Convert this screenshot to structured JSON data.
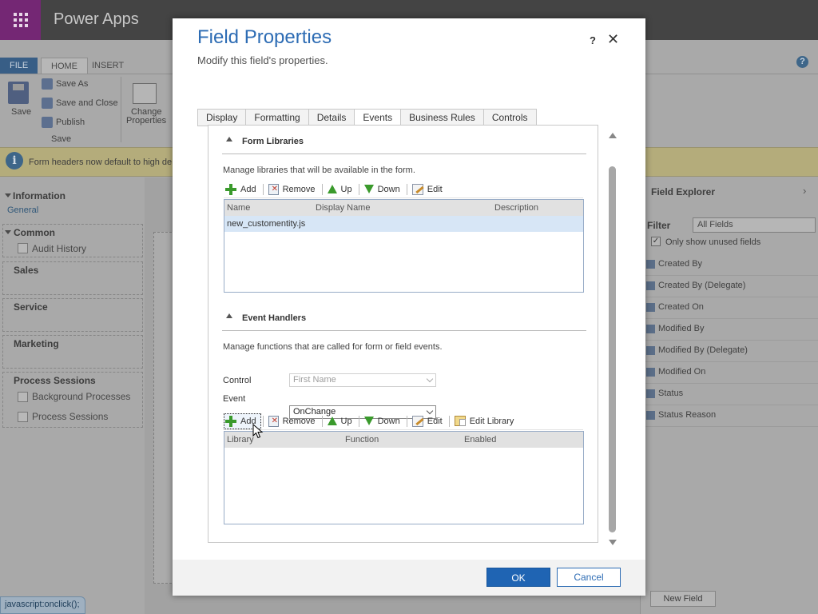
{
  "app": {
    "title": "Power Apps"
  },
  "ribbon": {
    "tabs": {
      "file": "FILE",
      "home": "HOME",
      "insert": "INSERT"
    },
    "save": "Save",
    "save_as": "Save As",
    "save_and_close": "Save and Close",
    "publish": "Publish",
    "group_save": "Save",
    "change_properties_line1": "Change",
    "change_properties_line2": "Properties"
  },
  "notification": {
    "text": "Form headers now default to high de"
  },
  "nav": {
    "information": "Information",
    "general": "General",
    "common": "Common",
    "audit_history": "Audit History",
    "sales": "Sales",
    "service": "Service",
    "marketing": "Marketing",
    "process_sessions": "Process Sessions",
    "background_processes": "Background Processes",
    "process_sessions_item": "Process Sessions"
  },
  "field_explorer": {
    "title": "Field Explorer",
    "filter_label": "Filter",
    "filter_value": "All Fields",
    "only_unused": "Only show unused fields",
    "fields": [
      "Created By",
      "Created By (Delegate)",
      "Created On",
      "Modified By",
      "Modified By (Delegate)",
      "Modified On",
      "Status",
      "Status Reason"
    ],
    "new_field": "New Field"
  },
  "status_bar": {
    "text": "javascript:onclick();"
  },
  "dialog": {
    "title": "Field Properties",
    "subtitle": "Modify this field's properties.",
    "help": "?",
    "close": "✕",
    "tabs": [
      "Display",
      "Formatting",
      "Details",
      "Events",
      "Business Rules",
      "Controls"
    ],
    "form_libraries": {
      "title": "Form Libraries",
      "description": "Manage libraries that will be available in the form.",
      "toolbar": {
        "add": "Add",
        "remove": "Remove",
        "up": "Up",
        "down": "Down",
        "edit": "Edit"
      },
      "columns": {
        "name": "Name",
        "display_name": "Display Name",
        "description": "Description"
      },
      "rows": [
        "new_customentity.js"
      ]
    },
    "event_handlers": {
      "title": "Event Handlers",
      "description": "Manage functions that are called for form or field events.",
      "control_label": "Control",
      "control_value": "First Name",
      "event_label": "Event",
      "event_value": "OnChange",
      "toolbar": {
        "add": "Add",
        "remove": "Remove",
        "up": "Up",
        "down": "Down",
        "edit": "Edit",
        "edit_library": "Edit Library"
      },
      "columns": {
        "library": "Library",
        "function": "Function",
        "enabled": "Enabled"
      }
    },
    "ok": "OK",
    "cancel": "Cancel"
  }
}
